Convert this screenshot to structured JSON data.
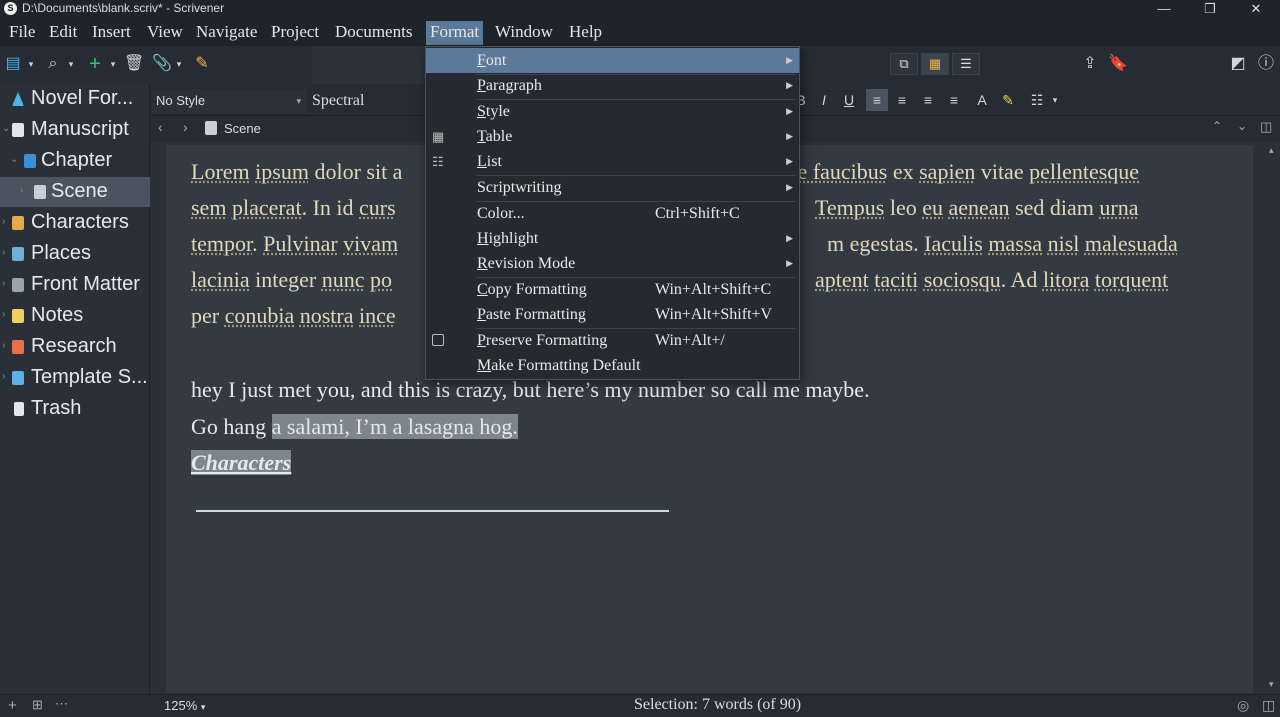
{
  "window": {
    "title": "D:\\Documents\\blank.scriv* - Scrivener",
    "minimize": "—",
    "restore": "❐",
    "close": "✕"
  },
  "menubar": {
    "items": [
      "File",
      "Edit",
      "Insert",
      "View",
      "Navigate",
      "Project",
      "Documents",
      "Format",
      "Window",
      "Help"
    ],
    "active": "Format"
  },
  "binder": {
    "items": [
      {
        "label": "Novel For...",
        "icon": "novel-format-icon",
        "color": "#4fb3e8"
      },
      {
        "label": "Manuscript",
        "icon": "manuscript-icon",
        "color": "#dfe6ee"
      },
      {
        "label": "Chapter",
        "icon": "chapter-folder-icon",
        "color": "#3b8fd9"
      },
      {
        "label": "Scene",
        "icon": "document-icon",
        "color": "#c9d0d8"
      },
      {
        "label": "Characters",
        "icon": "characters-folder-icon",
        "color": "#e8a84a"
      },
      {
        "label": "Places",
        "icon": "places-folder-icon",
        "color": "#6fb0d9"
      },
      {
        "label": "Front Matter",
        "icon": "front-matter-icon",
        "color": "#9aa4ae"
      },
      {
        "label": "Notes",
        "icon": "notes-folder-icon",
        "color": "#f0d060"
      },
      {
        "label": "Research",
        "icon": "research-folder-icon",
        "color": "#e86f4a"
      },
      {
        "label": "Template S...",
        "icon": "template-folder-icon",
        "color": "#5fb0e8"
      },
      {
        "label": "Trash",
        "icon": "trash-icon",
        "color": "#dfe6ee"
      }
    ]
  },
  "formatbar": {
    "style": "No Style",
    "font": "Spectral"
  },
  "header": {
    "doc_title": "Scene"
  },
  "editor": {
    "lines": [
      {
        "a": "Lorem",
        "b": "ipsum",
        "c": " dolor sit a",
        "gap": "sque",
        "d": " faucibus",
        "e": " ex ",
        "f": "sapien",
        "g": " vitae ",
        "h": "pellentesque"
      },
      {
        "a": "sem",
        "b": "placerat",
        "c": ". In id ",
        "d": "curs",
        "e": "Tempus",
        "f": " leo ",
        "g": "eu",
        "h": "aenean",
        "i": " sed diam ",
        "j": "urna"
      },
      {
        "a": "tempor",
        "b": ". ",
        "c": "Pulvinar",
        "d": "vivam",
        "e": "m egestas. ",
        "f": "Iaculis",
        "g": "massa",
        "h": "nisl",
        "i": "malesuada"
      },
      {
        "a": "lacinia",
        "b": " integer ",
        "c": "nunc",
        "d": "po",
        "e": "aptent",
        "f": "taciti",
        "g": "sociosqu",
        "h": ". Ad ",
        "i": "litora",
        "j": "torquent"
      },
      {
        "a": "per ",
        "b": "conubia",
        "c": "nostra",
        "d": "ince"
      }
    ],
    "para2_line1": "hey I just met you, and this is crazy, but here’s my number so call me maybe.",
    "para2_line2_plain": "Go hang ",
    "para2_line2_sel": "a salami, I’m a lasagna hog.",
    "heading": "Characters"
  },
  "format_menu": {
    "items": [
      {
        "label": "Font",
        "accel": "F",
        "rest": "ont",
        "shortcut": "",
        "submenu": true,
        "icon": ""
      },
      {
        "label": "Paragraph",
        "accel": "P",
        "rest": "aragraph",
        "shortcut": "",
        "submenu": true,
        "icon": ""
      },
      {
        "label": "Style",
        "accel": "S",
        "rest": "tyle",
        "shortcut": "",
        "submenu": true,
        "icon": ""
      },
      {
        "label": "Table",
        "accel": "T",
        "rest": "able",
        "shortcut": "",
        "submenu": true,
        "icon": "table-icon"
      },
      {
        "label": "List",
        "accel": "L",
        "rest": "ist",
        "shortcut": "",
        "submenu": true,
        "icon": "list-icon"
      },
      {
        "label": "Scriptwriting",
        "accel": "",
        "rest": "",
        "shortcut": "",
        "submenu": true,
        "icon": ""
      },
      {
        "label": "Color...",
        "accel": "",
        "rest": "",
        "shortcut": "Ctrl+Shift+C",
        "submenu": false,
        "icon": ""
      },
      {
        "label": "Highlight",
        "accel": "H",
        "rest": "ighlight",
        "shortcut": "",
        "submenu": true,
        "icon": ""
      },
      {
        "label": "Revision Mode",
        "accel": "R",
        "rest": "evision Mode",
        "shortcut": "",
        "submenu": true,
        "icon": ""
      },
      {
        "label": "Copy Formatting",
        "accel": "C",
        "rest": "opy Formatting",
        "shortcut": "Win+Alt+Shift+C",
        "submenu": false,
        "icon": ""
      },
      {
        "label": "Paste Formatting",
        "accel": "P",
        "rest": "aste Formatting",
        "shortcut": "Win+Alt+Shift+V",
        "submenu": false,
        "icon": ""
      },
      {
        "label": "Preserve Formatting",
        "accel": "P",
        "rest": "reserve Formatting",
        "shortcut": "Win+Alt+/",
        "submenu": false,
        "icon": "checkbox-icon"
      },
      {
        "label": "Make Formatting Default",
        "accel": "M",
        "rest": "ake Formatting Default",
        "shortcut": "",
        "submenu": false,
        "icon": ""
      }
    ]
  },
  "statusbar": {
    "zoom": "125%",
    "selection": "Selection: 7 words (of 90)"
  },
  "colors": {
    "accent": "#5b7a99",
    "text_underlined": "#e0d8b8",
    "selection": "#7d858d"
  }
}
